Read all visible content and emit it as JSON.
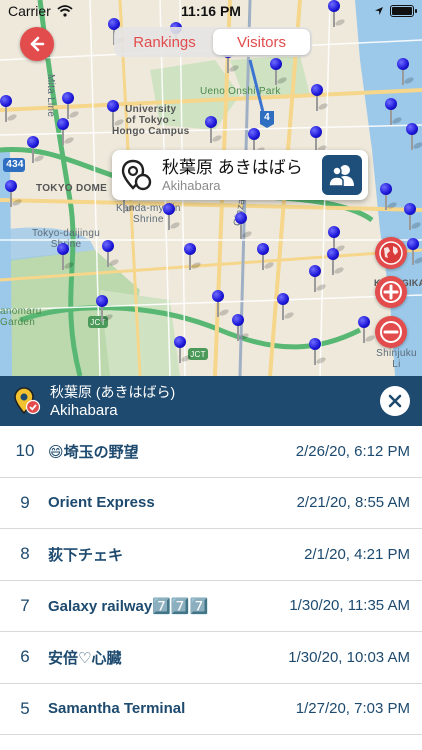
{
  "status_bar": {
    "carrier": "Carrier",
    "time": "11:16 PM",
    "wifi_icon": "wifi-icon",
    "location_icon": "location-arrow-icon",
    "battery_icon": "battery-icon"
  },
  "nav": {
    "back_icon": "back-arrow-icon",
    "tabs": [
      {
        "label": "Rankings",
        "active": false
      },
      {
        "label": "Visitors",
        "active": true
      }
    ]
  },
  "map": {
    "labels": {
      "mita_line": "Mita Line",
      "university": "University\nof Tokyo -\nHongo Campus",
      "ueno_park": "Ueno Onshi Park",
      "tokyo_dome": "TOKYO DOME",
      "kanda_shrine": "Kanda-myojin\nShrine",
      "daijingu": "Tokyo-daijingu\nShrine",
      "ginza_line": "Ginza Line",
      "garden": "anomaru\nGarden",
      "shinjuku_line": "Shinjuku Li",
      "kokugikan": "KOKUGIKAN",
      "route_434": "434",
      "route_4": "4",
      "jct_1": "JCT",
      "jct_2": "JCT"
    },
    "callout": {
      "title": "秋葉原 あきはばら",
      "subtitle": "Akihabara",
      "pin_icon": "map-pin-outline-icon",
      "visitors_icon": "users-icon"
    },
    "controls": {
      "globe_icon": "globe-icon",
      "zoom_in_icon": "zoom-in-icon",
      "zoom_out_icon": "zoom-out-icon"
    }
  },
  "station": {
    "title_ja": "秋葉原 (あきはばら)",
    "title_en": "Akihabara",
    "icon": "station-pin-check-icon",
    "close_icon": "close-icon"
  },
  "visitors": [
    {
      "rank": "10",
      "name": "😄埼玉の野望",
      "date": "2/26/20, 6:12 PM"
    },
    {
      "rank": "9",
      "name": "Orient Express",
      "date": "2/21/20, 8:55 AM"
    },
    {
      "rank": "8",
      "name": "荻下チェキ",
      "date": "2/1/20, 4:21 PM"
    },
    {
      "rank": "7",
      "name": "Galaxy railway7️⃣7️⃣7️⃣",
      "date": "1/30/20, 11:35 AM"
    },
    {
      "rank": "6",
      "name": "安倍♡心臓",
      "date": "1/30/20, 10:03 AM"
    },
    {
      "rank": "5",
      "name": "Samantha Terminal",
      "date": "1/27/20, 7:03 PM"
    }
  ]
}
